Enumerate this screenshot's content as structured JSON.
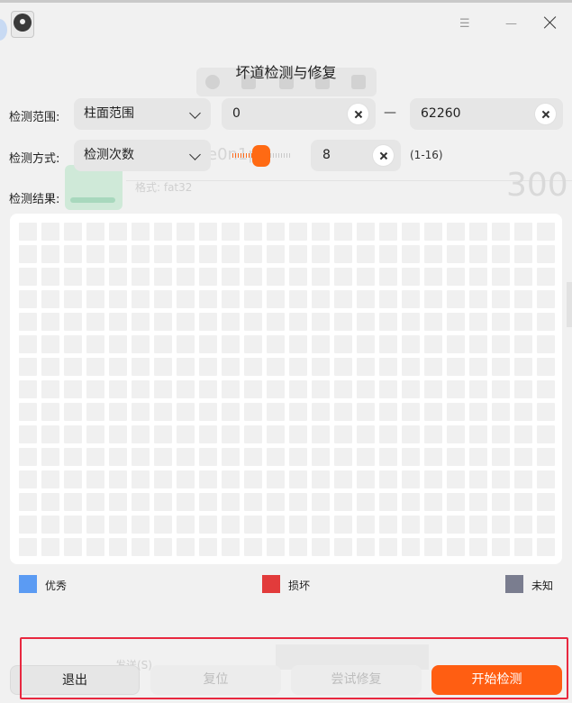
{
  "window": {
    "title": "坏道检测与修复",
    "minimize_glyph": "☰",
    "maximize_glyph": "—",
    "close_icon": "close-icon"
  },
  "background_ghost": {
    "device_text": "e0n1p",
    "format_text": "格式: fat32",
    "big_number": "300",
    "send_text": "发送(S)"
  },
  "range": {
    "label": "检测范围:",
    "mode_selected": "柱面范围",
    "start_value": "0",
    "separator": "—",
    "end_value": "62260"
  },
  "method": {
    "label": "检测方式:",
    "mode_selected": "检测次数",
    "count_value": "8",
    "count_hint": "(1-16)",
    "slider_level_fraction": 0.5
  },
  "results": {
    "label": "检测结果:",
    "grid_columns": 24,
    "grid_rows": 15
  },
  "legend": [
    {
      "label": "优秀",
      "color": "#5b9bf3"
    },
    {
      "label": "损坏",
      "color": "#e23b3b"
    },
    {
      "label": "未知",
      "color": "#7a7d8f"
    }
  ],
  "buttons": {
    "exit": "退出",
    "reset": "复位",
    "try_repair": "尝试修复",
    "start": "开始检测"
  },
  "colors": {
    "accent": "#ff5e12",
    "highlight_border": "#e8283f"
  }
}
